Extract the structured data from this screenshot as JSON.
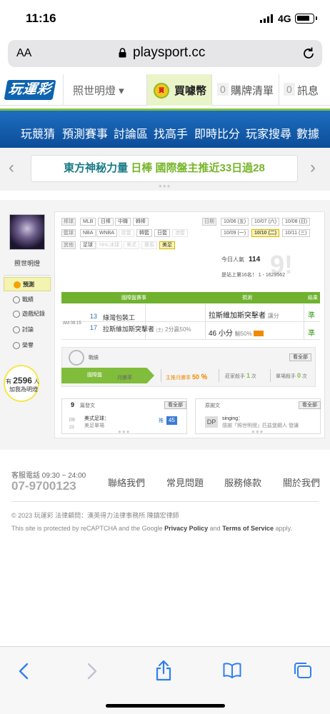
{
  "status_bar": {
    "time": "11:16",
    "network": "4G"
  },
  "browser": {
    "text_size": "AA",
    "domain": "playsport.cc"
  },
  "site_header": {
    "logo": "玩運彩",
    "lamp": "照世明燈 ▾",
    "buy_icon": "買",
    "buy_label": "買噱幣",
    "cart_count": "0",
    "cart_label": "購牌清單",
    "msg_count": "0",
    "msg_label": "訊息"
  },
  "nav": {
    "items": [
      "玩競猜",
      "預測賽事",
      "討論區",
      "找高手",
      "即時比分",
      "玩家搜尋",
      "數據"
    ]
  },
  "banner": {
    "text_a": "東方神秘力量",
    "text_b": "日棒 國際盤主推近33日過28",
    "prev": "‹",
    "next": "›",
    "dots": "●●●"
  },
  "profile": {
    "name": "照世明燈",
    "menu": [
      "預測",
      "戰績",
      "遊戲紀錄",
      "討論",
      "榮譽"
    ],
    "fans_prefix": "有",
    "fans_count": "2596",
    "fans_suffix": "人",
    "fans_sub": "加我為明燈"
  },
  "filters": {
    "rows": [
      {
        "label": "棒球",
        "tags": [
          "MLB",
          "日棒",
          "中職",
          "韓棒"
        ]
      },
      {
        "label": "籃球",
        "tags": [
          "NBA",
          "WNBA",
          "歐籃",
          "韓籃",
          "日籃",
          "澳籃"
        ]
      },
      {
        "label": "其他",
        "tags": [
          "足球",
          "NHL冰球",
          "美式",
          "賽馬",
          "美足"
        ]
      }
    ],
    "date_label": "日期",
    "dates": [
      "10/06 (五)",
      "10/07 (六)",
      "10/08 (日)",
      "10/09 (一)",
      "10/10 (二)",
      "10/11 (三)"
    ]
  },
  "stats": {
    "pop_label": "今日人氣",
    "pop_value": "114",
    "rank": "是站上第16名！ 1 - 1629562",
    "watermark": "9!"
  },
  "table": {
    "headers": [
      "國際盤賽事",
      "預測",
      "結果"
    ],
    "time": "AM 08:15",
    "rows": [
      {
        "num": "13",
        "team": "綠灣包裝工",
        "pick": "拉斯維加斯突擊者",
        "pick_sub": "讓分",
        "result": "準"
      },
      {
        "num": "17",
        "team": "拉斯維加斯突擊者",
        "team_extra": "(主)",
        "team_note": "2分贏50%",
        "pick": "46 小分",
        "pick_sub": "輸50%",
        "result": "準"
      }
    ]
  },
  "record": {
    "label": "戰績",
    "more": "看全部",
    "tab": "國際盤",
    "month_label": "月勝率",
    "month_val": "50 ％",
    "main_label": "主推月勝率",
    "main_val": "50 ％",
    "streak_label": "莊家殺手",
    "streak_val": "1",
    "streak_unit": "次",
    "single_label": "單場殺手",
    "single_val": "0",
    "single_unit": "次"
  },
  "posts": {
    "count": "9",
    "label": "篇發文",
    "more": "看全部",
    "date_top": "09",
    "date_bottom": "23",
    "title_a": "美式足球：",
    "title_b": "美足單場",
    "push": "推",
    "push_count": "45"
  },
  "replies": {
    "label": "原謝文",
    "more": "看全部",
    "icon": "DP",
    "line_a": "singing：",
    "line_b": "感謝「照世明燈」匹茲堡鋼人 發讓"
  },
  "footer": {
    "service": "客服電話 09:30 ~ 24:00",
    "phone": "07-9700123",
    "links": [
      "聯絡我們",
      "常見問題",
      "服務條款",
      "關於我們"
    ],
    "copyright": "© 2023 玩運彩 法律顧問：漢英得力法律事務所 陳鎮宏律師",
    "recap_a": "This site is protected by reCAPTCHA and the Google ",
    "recap_pp": "Privacy Policy",
    "recap_and": " and ",
    "recap_tos": "Terms of Service",
    "recap_end": " apply."
  }
}
